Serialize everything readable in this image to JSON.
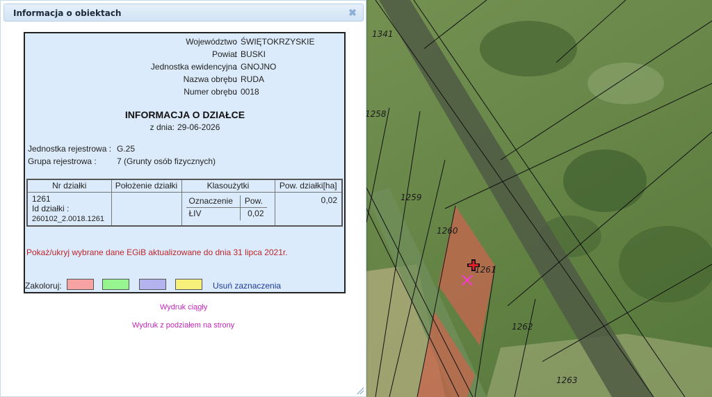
{
  "dialog": {
    "title": "Informacja o obiektach",
    "close_glyph": "✖"
  },
  "location": {
    "wojewodztwo_label": "Województwo",
    "wojewodztwo_value": "ŚWIĘTOKRZYSKIE",
    "powiat_label": "Powiat",
    "powiat_value": "BUSKI",
    "jednostka_label": "Jednostka ewidencyjna",
    "jednostka_value": "GNOJNO",
    "obreb_label": "Nazwa obrębu",
    "obreb_value": "RUDA",
    "numer_obrebu_label": "Numer obrębu",
    "numer_obrebu_value": "0018",
    "separator": ":"
  },
  "info": {
    "heading": "INFORMACJA O DZIAŁCE",
    "date_prefix": "z dnia:",
    "date_value": "29-06-2026"
  },
  "registry": {
    "unit_label": "Jednostka rejestrowa :",
    "unit_value": "G.25",
    "group_label": "Grupa rejestrowa :",
    "group_value": "7 (Grunty osób fizycznych)"
  },
  "table": {
    "headers": [
      "Nr działki",
      "Położenie działki",
      "Klasoużytki",
      "Pow. działki[ha]"
    ],
    "parcel_number": "1261",
    "parcel_id_label": "Id działki :",
    "parcel_id_value": "260102_2.0018.1261",
    "location_value": "",
    "class_headers": [
      "Oznaczenie",
      "Pow."
    ],
    "class_rows": [
      {
        "symbol": "ŁIV",
        "area": "0,02"
      }
    ],
    "parcel_area": "0,02"
  },
  "notice": "Pokaż/ukryj wybrane dane EGiB aktualizowane do dnia 31 lipca 2021r.",
  "colorize": {
    "label": "Zakoloruj:",
    "swatches": [
      "#f7a3a3",
      "#97f58f",
      "#b4b2ef",
      "#f7f07a"
    ],
    "clear_label": "Usuń zaznaczenia"
  },
  "print": {
    "continuous": "Wydruk ciągły",
    "paged": "Wydruk z podziałem na strony"
  },
  "map": {
    "parcel_labels": [
      "1341",
      "1258",
      "1259",
      "1260",
      "1261",
      "1262",
      "1263"
    ],
    "highlight_color": "#c8664f"
  }
}
